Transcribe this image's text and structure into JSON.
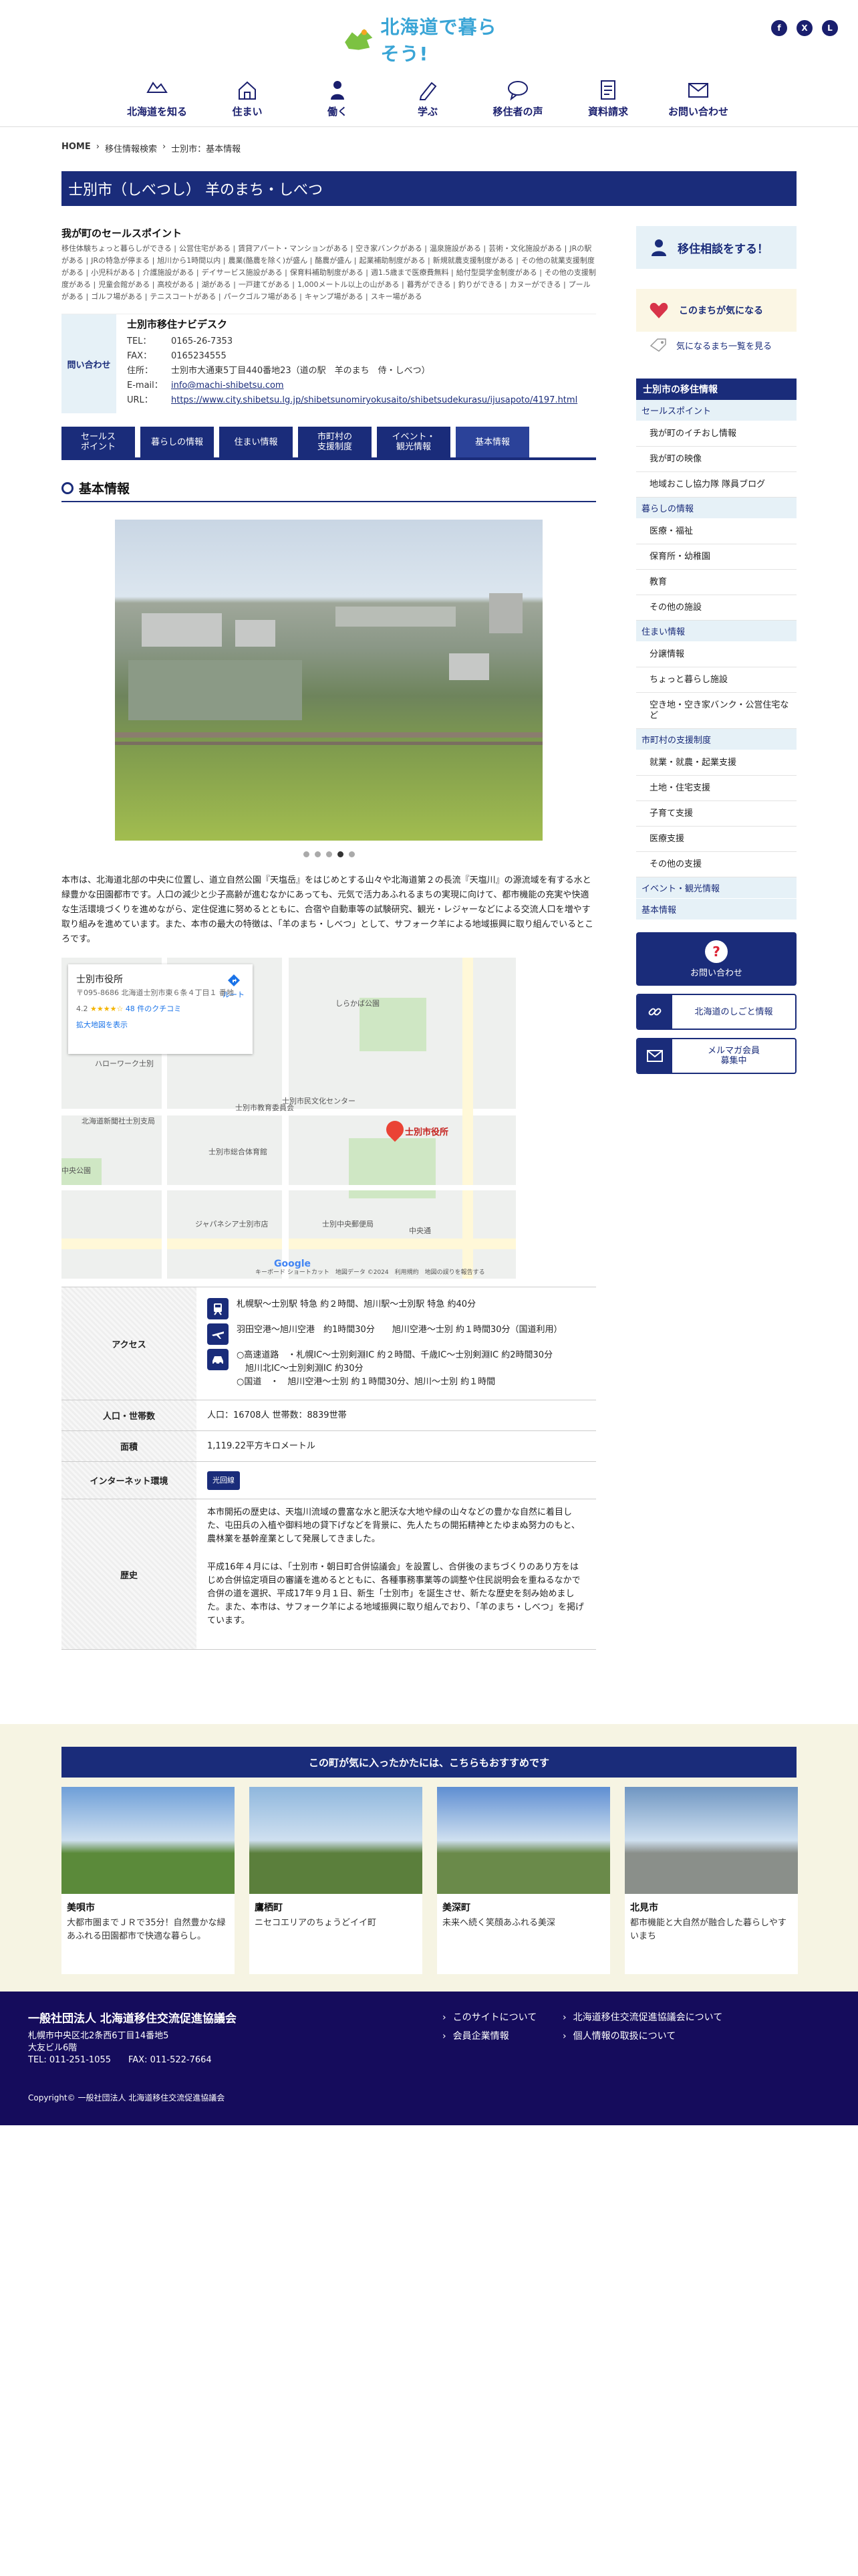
{
  "header": {
    "logo_text": "北海道で暮らそう!",
    "social": [
      {
        "icon": "facebook-icon",
        "glyph": "f"
      },
      {
        "icon": "x-icon",
        "glyph": "X"
      },
      {
        "icon": "line-icon",
        "glyph": "L"
      }
    ],
    "nav": [
      {
        "label": "北海道を知る",
        "icon": "map-icon"
      },
      {
        "label": "住まい",
        "icon": "house-icon"
      },
      {
        "label": "働く",
        "icon": "worker-icon"
      },
      {
        "label": "学ぶ",
        "icon": "pencil-icon"
      },
      {
        "label": "移住者の声",
        "icon": "speech-icon"
      },
      {
        "label": "資料請求",
        "icon": "document-icon"
      },
      {
        "label": "お問い合わせ",
        "icon": "mail-icon"
      }
    ]
  },
  "breadcrumb": {
    "home": "HOME",
    "sep": "›",
    "level1": "移住情報検索",
    "current": "士別市：基本情報"
  },
  "title": "士別市（しべつし） 羊のまち・しべつ",
  "sales_points": {
    "heading": "我が町のセールスポイント",
    "tags": [
      "移住体験ちょっと暮らしができる",
      "公営住宅がある",
      "賃貸アパート・マンションがある",
      "空き家バンクがある",
      "温泉施設がある",
      "芸術・文化施設がある",
      "JRの駅がある",
      "JRの特急が停まる",
      "旭川から1時間以内",
      "農業(酪農を除く)が盛ん",
      "酪農が盛ん",
      "起業補助制度がある",
      "新規就農支援制度がある",
      "その他の就業支援制度がある",
      "小児科がある",
      "介護施設がある",
      "デイサービス施設がある",
      "保育料補助制度がある",
      "週1.5歳まで医療費無料",
      "給付型奨学金制度がある",
      "その他の支援制度がある",
      "児童会館がある",
      "高校がある",
      "湖がある",
      "一戸建てがある",
      "1,000メートル以上の山がある",
      "暮秀ができる",
      "釣りができる",
      "カヌーができる",
      "プールがある",
      "ゴルフ場がある",
      "テニスコートがある",
      "パークゴルフ場がある",
      "キャンプ場がある",
      "スキー場がある"
    ]
  },
  "contact": {
    "label": "問い合わせ",
    "name": "士別市移住ナビデスク",
    "tel_k": "TEL：",
    "tel": "0165-26-7353",
    "fax_k": "FAX：",
    "fax": "0165234555",
    "addr_k": "住所：",
    "addr": "士別市大通東5丁目440番地23（道の駅　羊のまち　侍・しべつ）",
    "mail_k": "E-mail：",
    "mail": "info@machi-shibetsu.com",
    "url_k": "URL：",
    "url": "https://www.city.shibetsu.lg.jp/shibetsunomiryokusaito/shibetsudekurasu/ijusapoto/4197.html"
  },
  "tabs": [
    {
      "label": "セールス\nポイント"
    },
    {
      "label": "暮らしの情報"
    },
    {
      "label": "住まい情報"
    },
    {
      "label": "市町村の\n支援制度"
    },
    {
      "label": "イベント・\n観光情報"
    },
    {
      "label": "基本情報",
      "active": true
    }
  ],
  "section_title": "基本情報",
  "slider": {
    "count": 5,
    "active_index": 3
  },
  "intro": "本市は、北海道北部の中央に位置し、道立自然公園『天塩岳』をはじめとする山々や北海道第２の長流『天塩川』の源流域を有する水と緑豊かな田園都市です。人口の減少と少子高齢が進むなかにあっても、元気で活力あふれるまちの実現に向けて、都市機能の充実や快適な生活環境づくりを進めながら、定住促進に努めるとともに、合宿や自動車等の試験研究、観光・レジャーなどによる交流人口を増やす取り組みを進めています。また、本市の最大の特徴は、「羊のまち・しべつ」として、サフォーク羊による地域振興に取り組んでいるところです。",
  "map": {
    "place": "士別市役所",
    "addr": "〒095-8686 北海道士別市東６条４丁目１ 番地",
    "rating": "4.2",
    "stars": "★★★★☆",
    "reviews": "48 件のクチコミ",
    "enlarge": "拡大地図を表示",
    "route": "ルート",
    "pin_label": "士別市役所",
    "labels": [
      "しらかば公園",
      "ハローワーク士別",
      "士別市民文化センター",
      "北海道新聞社士別支局",
      "士別市総合体育館",
      "士別市教育委員会",
      "中央公園",
      "ジャパネシア士別市店",
      "士別中央郵便局",
      "中央通"
    ],
    "google": "Google",
    "footer": "キーボード ショートカット　地図データ ©2024　利用規約　地図の誤りを報告する"
  },
  "table": {
    "access_label": "アクセス",
    "access": [
      {
        "icon": "train-icon",
        "text": "札幌駅〜士別駅 特急 約２時間、旭川駅〜士別駅 特急 約40分"
      },
      {
        "icon": "plane-icon",
        "text": "羽田空港〜旭川空港　約1時間30分　　旭川空港〜士別 約１時間30分（国道利用）"
      },
      {
        "icon": "car-icon",
        "text": "○高速道路　・札幌IC〜士別剣淵IC 約２時間、千歳IC〜士別剣淵IC 約2時間30分\n　旭川北IC〜士別剣淵IC 約30分\n○国道　・　旭川空港〜士別 約１時間30分、旭川〜士別 約１時間"
      }
    ],
    "pop_label": "人口・世帯数",
    "pop": "人口：16708人 世帯数：8839世帯",
    "area_label": "面積",
    "area": "1,119.22平方キロメートル",
    "net_label": "インターネット環境",
    "net": "光回線",
    "hist_label": "歴史",
    "hist1": "本市開拓の歴史は、天塩川流域の豊富な水と肥沃な大地や緑の山々などの豊かな自然に着目した、屯田兵の入植や御料地の貸下げなどを背景に、先人たちの開拓精神とたゆまぬ努力のもと、農林業を基幹産業として発展してきました。",
    "hist2": "平成16年４月には、「士別市・朝日町合併協議会」を設置し、合併後のまちづくりのあり方をはじめ合併協定項目の審議を進めるとともに、各種事務事業等の調整や住民説明会を重ねるなかで合併の道を選択、平成17年９月１日、新生「士別市」を誕生させ、新たな歴史を刻み始めました。また、本市は、サフォーク羊による地域振興に取り組んでおり、「羊のまち・しべつ」を掲げています。"
  },
  "sidebar": {
    "consult": "移住相談をする！",
    "fav": "このまちが気になる",
    "fav_list": "気になるまち一覧を見る",
    "menu_head": "士別市の移住情報",
    "menu": [
      {
        "type": "cat",
        "label": "セールスポイント"
      },
      {
        "type": "item",
        "label": "我が町のイチおし情報"
      },
      {
        "type": "item",
        "label": "我が町の映像"
      },
      {
        "type": "item",
        "label": "地域おこし協力隊 隊員ブログ"
      },
      {
        "type": "cat",
        "label": "暮らしの情報"
      },
      {
        "type": "item",
        "label": "医療・福祉"
      },
      {
        "type": "item",
        "label": "保育所・幼稚園"
      },
      {
        "type": "item",
        "label": "教育"
      },
      {
        "type": "item",
        "label": "その他の施設"
      },
      {
        "type": "cat",
        "label": "住まい情報"
      },
      {
        "type": "item",
        "label": "分譲情報"
      },
      {
        "type": "item",
        "label": "ちょっと暮らし施設"
      },
      {
        "type": "item",
        "two": true,
        "label": "空き地・空き家バンク・公営住宅など"
      },
      {
        "type": "cat",
        "label": "市町村の支援制度"
      },
      {
        "type": "item",
        "label": "就業・就農・起業支援"
      },
      {
        "type": "item",
        "label": "土地・住宅支援"
      },
      {
        "type": "item",
        "label": "子育て支援"
      },
      {
        "type": "item",
        "label": "医療支援"
      },
      {
        "type": "item",
        "label": "その他の支援"
      },
      {
        "type": "cat",
        "label": "イベント・観光情報"
      },
      {
        "type": "cat",
        "label": "基本情報"
      }
    ],
    "inquiry": "お問い合わせ",
    "job": "北海道のしごと情報",
    "mailmag": "メルマガ会員\n募集中"
  },
  "recommend": {
    "heading": "この町が気に入ったかたには、こちらもおすすめです",
    "cards": [
      {
        "name": "美唄市",
        "desc": "大都市圏までＪＲで35分！自然豊かな緑あふれる田園都市で快適な暮らし。",
        "c1": "#6e9fd8",
        "c2": "#5b8a3a"
      },
      {
        "name": "鷹栖町",
        "desc": "ニセコエリアのちょうどイイ町",
        "c1": "#8fb7dd",
        "c2": "#5b7f3c"
      },
      {
        "name": "美深町",
        "desc": "未来へ続く笑顔あふれる美深",
        "c1": "#5e8ed2",
        "c2": "#6a8a4a"
      },
      {
        "name": "北見市",
        "desc": "都市機能と大自然が融合した暮らしやすいまち",
        "c1": "#6f96c2",
        "c2": "#8a8f8a"
      }
    ]
  },
  "footer": {
    "org": "一般社団法人 北海道移住交流促進協議会",
    "addr1": "札幌市中央区北2条西6丁目14番地5",
    "addr2": "大友ビル6階",
    "tel": "TEL: 011-251-1055　　FAX: 011-522-7664",
    "links": [
      "このサイトについて",
      "北海道移住交流促進協議会について",
      "会員企業情報",
      "個人情報の取扱について"
    ],
    "copy": "Copyright© 一般社団法人 北海道移住交流促進協議会"
  },
  "colors": {
    "navy": "#1a2c7a",
    "footer": "#150c5c",
    "light_blue": "#e6f1f7",
    "cream": "#f6f4e3"
  }
}
